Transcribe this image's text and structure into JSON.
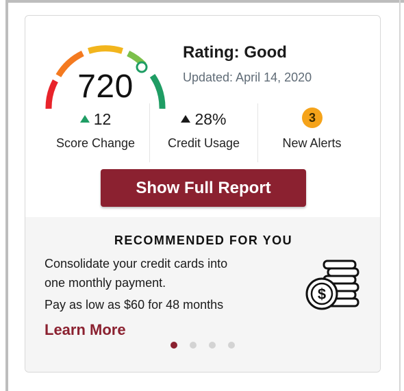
{
  "score_card": {
    "score": "720",
    "score_fraction": 0.72,
    "rating": "Rating: Good",
    "updated": "Updated: April 14, 2020",
    "gauge_colors": [
      "#e8232a",
      "#f47a20",
      "#f2b51d",
      "#7cc04b",
      "#1f9d64"
    ]
  },
  "stats": [
    {
      "value": "12",
      "label": "Score Change",
      "trend_icon": "triangle-up-green-icon"
    },
    {
      "value": "28%",
      "label": "Credit Usage",
      "trend_icon": "triangle-up-icon"
    },
    {
      "value": "3",
      "label": "New Alerts",
      "badge_color": "#f5a31a"
    }
  ],
  "cta": {
    "label": "Show Full Report",
    "color": "#8b2130"
  },
  "recommendation": {
    "title": "RECOMMENDED FOR YOU",
    "line1": "Consolidate your credit cards into",
    "line2": "one monthly payment.",
    "line3": "Pay as low as $60 for 48 months",
    "link": "Learn More",
    "icon": "coin-stack-icon"
  },
  "carousel": {
    "count": 4,
    "active_index": 0
  }
}
